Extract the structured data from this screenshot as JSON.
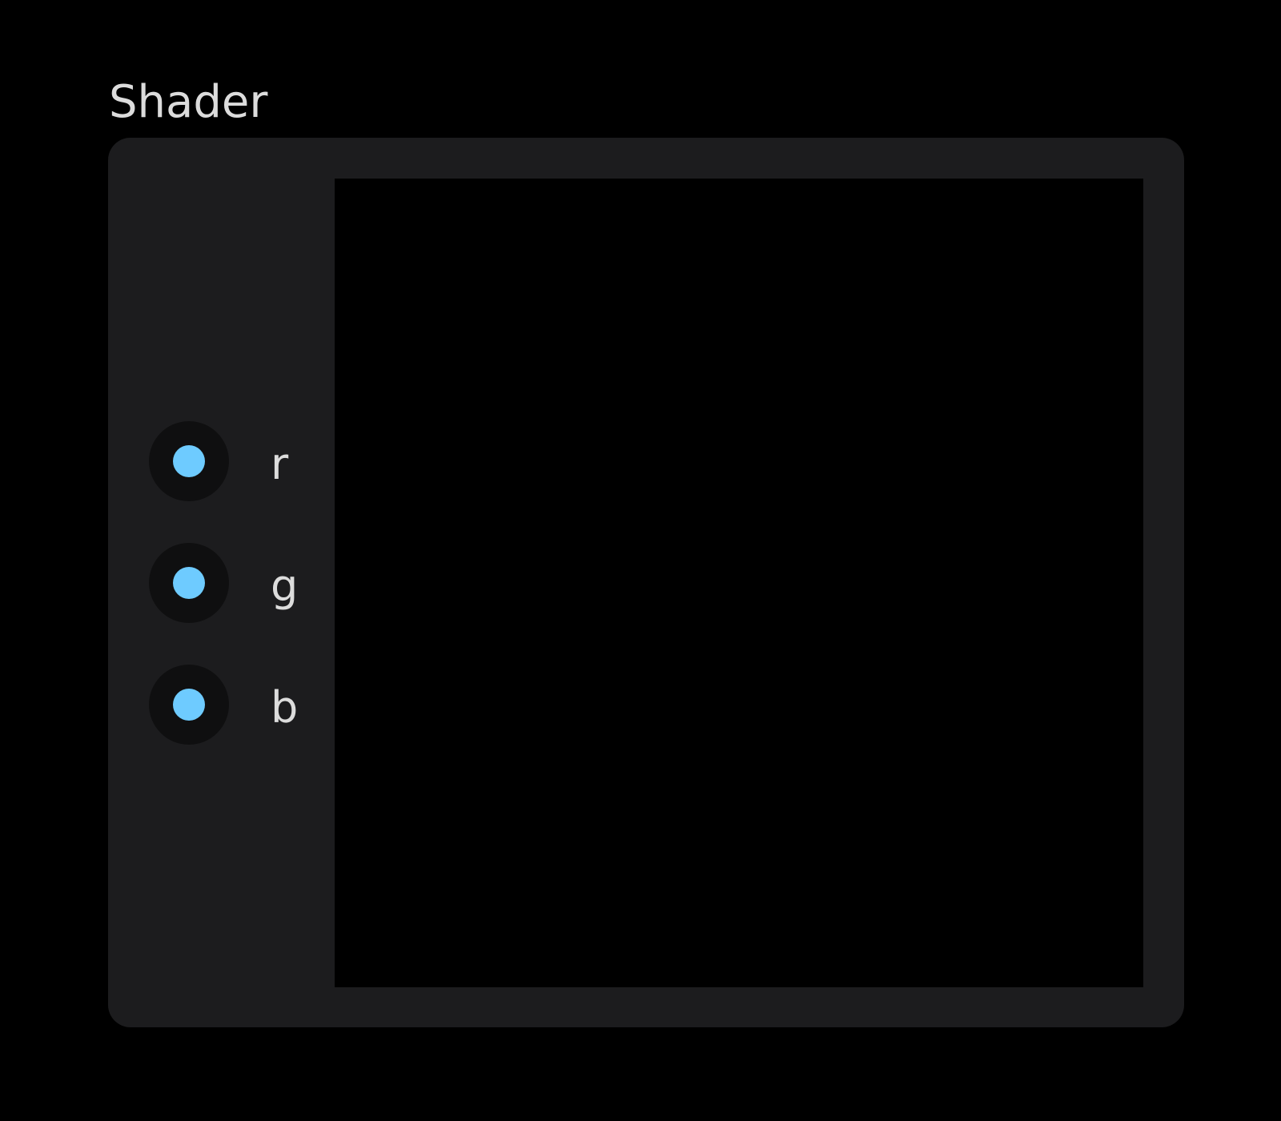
{
  "node": {
    "title": "Shader",
    "inputs": [
      {
        "label": "r",
        "color": "#6ecbff"
      },
      {
        "label": "g",
        "color": "#6ecbff"
      },
      {
        "label": "b",
        "color": "#6ecbff"
      }
    ]
  }
}
